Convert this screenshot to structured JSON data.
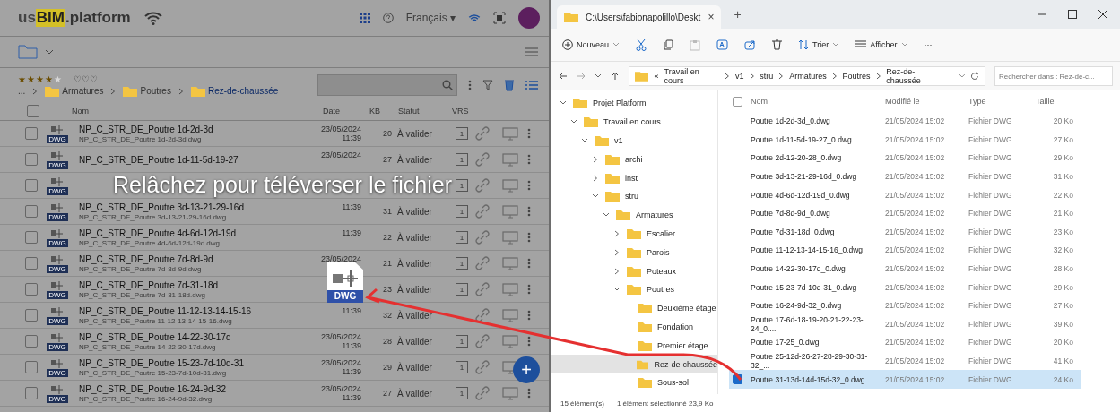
{
  "left": {
    "logo": {
      "prefix": "us",
      "brand": "BIM",
      "suffix": ".platform"
    },
    "language": "Français ▾",
    "rating": {
      "stars": 4,
      "shields": "♡♡♡"
    },
    "breadcrumb": {
      "more": "...",
      "items": [
        {
          "label": "Armatures",
          "selected": false
        },
        {
          "label": "Poutres",
          "selected": false
        },
        {
          "label": "Rez-de-chaussée",
          "selected": true
        }
      ]
    },
    "columns": [
      "Nom",
      "Date",
      "KB",
      "Statut",
      "VRS"
    ],
    "select_all_checked": false,
    "rows": [
      {
        "checked": false,
        "badge": "DWG",
        "name": "NP_C_STR_DE_Poutre 1d-2d-3d",
        "file": "NP_C_STR_DE_Poutre 1d-2d-3d.dwg",
        "date": "23/05/2024",
        "time": "11:39",
        "kb": "20",
        "status": "À valider",
        "vrs": "1"
      },
      {
        "checked": false,
        "badge": "DWG",
        "name": "NP_C_STR_DE_Poutre 1d-11-5d-19-27",
        "date": "23/05/2024",
        "kb": "27",
        "status": "À valider",
        "vrs": "1"
      },
      {
        "checked": false,
        "badge": "DWG",
        "vrs": "1"
      },
      {
        "checked": false,
        "badge": "DWG",
        "name": "NP_C_STR_DE_Poutre 3d-13-21-29-16d",
        "file": "NP_C_STR_DE_Poutre 3d-13-21-29-16d.dwg",
        "time": "11:39",
        "kb": "31",
        "status": "À valider",
        "vrs": "1"
      },
      {
        "checked": false,
        "badge": "DWG",
        "name": "NP_C_STR_DE_Poutre 4d-6d-12d-19d",
        "file": "NP_C_STR_DE_Poutre 4d-6d-12d-19d.dwg",
        "time": "11:39",
        "kb": "22",
        "status": "À valider",
        "vrs": "1"
      },
      {
        "checked": false,
        "badge": "DWG",
        "name": "NP_C_STR_DE_Poutre 7d-8d-9d",
        "file": "NP_C_STR_DE_Poutre 7d-8d-9d.dwg",
        "date": "23/05/2024",
        "kb": "21",
        "status": "À valider",
        "vrs": "1"
      },
      {
        "checked": false,
        "badge": "DWG",
        "name": "NP_C_STR_DE_Poutre 7d-31-18d",
        "file": "NP_C_STR_DE_Poutre 7d-31-18d.dwg",
        "kb": "23",
        "status": "À valider",
        "vrs": "1"
      },
      {
        "checked": false,
        "badge": "DWG",
        "name": "NP_C_STR_DE_Poutre 11-12-13-14-15-16",
        "file": "NP_C_STR_DE_Poutre 11-12-13-14-15-16.dwg",
        "time": "11:39",
        "kb": "32",
        "status": "À valider"
      },
      {
        "checked": false,
        "badge": "DWG",
        "name": "NP_C_STR_DE_Poutre 14-22-30-17d",
        "file": "NP_C_STR_DE_Poutre 14-22-30-17d.dwg",
        "date": "23/05/2024",
        "time": "11:39",
        "kb": "28",
        "status": "À valider",
        "vrs": "1"
      },
      {
        "checked": false,
        "badge": "DWG",
        "name": "NP_C_STR_DE_Poutre 15-23-7d-10d-31",
        "file": "NP_C_STR_DE_Poutre 15-23-7d-10d-31.dwg",
        "date": "23/05/2024",
        "time": "11:39",
        "kb": "29",
        "status": "À valider",
        "vrs": "1"
      },
      {
        "checked": false,
        "badge": "DWG",
        "name": "NP_C_STR_DE_Poutre 16-24-9d-32",
        "file": "NP_C_STR_DE_Poutre 16-24-9d-32.dwg",
        "date": "23/05/2024",
        "time": "11:39",
        "kb": "27",
        "status": "À valider",
        "vrs": "1"
      }
    ],
    "drop_message": "Relâchez pour téléverser le fichier",
    "drag_badge": "DWG",
    "fab": "+"
  },
  "explorer": {
    "tab": "C:\\Users\\fabionapolillo\\Deskt",
    "tab_close": "×",
    "new_tab": "+",
    "toolbar": {
      "new": "Nouveau",
      "sort": "Trier",
      "view": "Afficher",
      "more": "···"
    },
    "path": [
      "«",
      "Travail en cours",
      "v1",
      "stru",
      "Armatures",
      "Poutres",
      "Rez-de-chaussée"
    ],
    "search": {
      "placeholder": "Rechercher dans : Rez-de-c..."
    },
    "tree": [
      {
        "label": "Projet Platform",
        "expanded": true,
        "selected": false,
        "children": [
          {
            "label": "Travail en cours",
            "expanded": true,
            "selected": false,
            "children": [
              {
                "label": "v1",
                "expanded": true,
                "selected": false,
                "children": [
                  {
                    "label": "archi",
                    "expanded": false,
                    "selected": false
                  },
                  {
                    "label": "inst",
                    "expanded": false,
                    "selected": false
                  },
                  {
                    "label": "stru",
                    "expanded": true,
                    "selected": false,
                    "children": [
                      {
                        "label": "Armatures",
                        "expanded": true,
                        "selected": false,
                        "children": [
                          {
                            "label": "Escalier",
                            "expanded": false,
                            "selected": false
                          },
                          {
                            "label": "Parois",
                            "expanded": false,
                            "selected": false
                          },
                          {
                            "label": "Poteaux",
                            "expanded": false,
                            "selected": false
                          },
                          {
                            "label": "Poutres",
                            "expanded": true,
                            "selected": false,
                            "children": [
                              {
                                "label": "Deuxième étage",
                                "selected": false
                              },
                              {
                                "label": "Fondation",
                                "selected": false
                              },
                              {
                                "label": "Premier étage",
                                "selected": false
                              },
                              {
                                "label": "Rez-de-chaussée",
                                "selected": true
                              },
                              {
                                "label": "Sous-sol",
                                "selected": false
                              }
                            ]
                          }
                        ]
                      }
                    ]
                  }
                ]
              }
            ]
          }
        ]
      }
    ],
    "columns": [
      "Nom",
      "Modifié le",
      "Type",
      "Taille"
    ],
    "select_all_checked": false,
    "files": [
      {
        "name": "Poutre 1d-2d-3d_0.dwg",
        "modified": "21/05/2024 15:02",
        "type": "Fichier DWG",
        "size": "20 Ko",
        "selected": false
      },
      {
        "name": "Poutre 1d-11-5d-19-27_0.dwg",
        "modified": "21/05/2024 15:02",
        "type": "Fichier DWG",
        "size": "27 Ko",
        "selected": false
      },
      {
        "name": "Poutre 2d-12-20-28_0.dwg",
        "modified": "21/05/2024 15:02",
        "type": "Fichier DWG",
        "size": "29 Ko",
        "selected": false
      },
      {
        "name": "Poutre 3d-13-21-29-16d_0.dwg",
        "modified": "21/05/2024 15:02",
        "type": "Fichier DWG",
        "size": "31 Ko",
        "selected": false
      },
      {
        "name": "Poutre 4d-6d-12d-19d_0.dwg",
        "modified": "21/05/2024 15:02",
        "type": "Fichier DWG",
        "size": "22 Ko",
        "selected": false
      },
      {
        "name": "Poutre 7d-8d-9d_0.dwg",
        "modified": "21/05/2024 15:02",
        "type": "Fichier DWG",
        "size": "21 Ko",
        "selected": false
      },
      {
        "name": "Poutre 7d-31-18d_0.dwg",
        "modified": "21/05/2024 15:02",
        "type": "Fichier DWG",
        "size": "23 Ko",
        "selected": false
      },
      {
        "name": "Poutre 11-12-13-14-15-16_0.dwg",
        "modified": "21/05/2024 15:02",
        "type": "Fichier DWG",
        "size": "32 Ko",
        "selected": false
      },
      {
        "name": "Poutre 14-22-30-17d_0.dwg",
        "modified": "21/05/2024 15:02",
        "type": "Fichier DWG",
        "size": "28 Ko",
        "selected": false
      },
      {
        "name": "Poutre 15-23-7d-10d-31_0.dwg",
        "modified": "21/05/2024 15:02",
        "type": "Fichier DWG",
        "size": "29 Ko",
        "selected": false
      },
      {
        "name": "Poutre 16-24-9d-32_0.dwg",
        "modified": "21/05/2024 15:02",
        "type": "Fichier DWG",
        "size": "27 Ko",
        "selected": false
      },
      {
        "name": "Poutre 17-6d-18-19-20-21-22-23-24_0....",
        "modified": "21/05/2024 15:02",
        "type": "Fichier DWG",
        "size": "39 Ko",
        "selected": false
      },
      {
        "name": "Poutre 17-25_0.dwg",
        "modified": "21/05/2024 15:02",
        "type": "Fichier DWG",
        "size": "20 Ko",
        "selected": false
      },
      {
        "name": "Poutre 25-12d-26-27-28-29-30-31-32_...",
        "modified": "21/05/2024 15:02",
        "type": "Fichier DWG",
        "size": "41 Ko",
        "selected": false
      },
      {
        "name": "Poutre 31-13d-14d-15d-32_0.dwg",
        "modified": "21/05/2024 15:02",
        "type": "Fichier DWG",
        "size": "24 Ko",
        "selected": true
      }
    ],
    "status": {
      "count": "15 élément(s)",
      "selection": "1 élément sélectionné 23,9 Ko"
    }
  }
}
